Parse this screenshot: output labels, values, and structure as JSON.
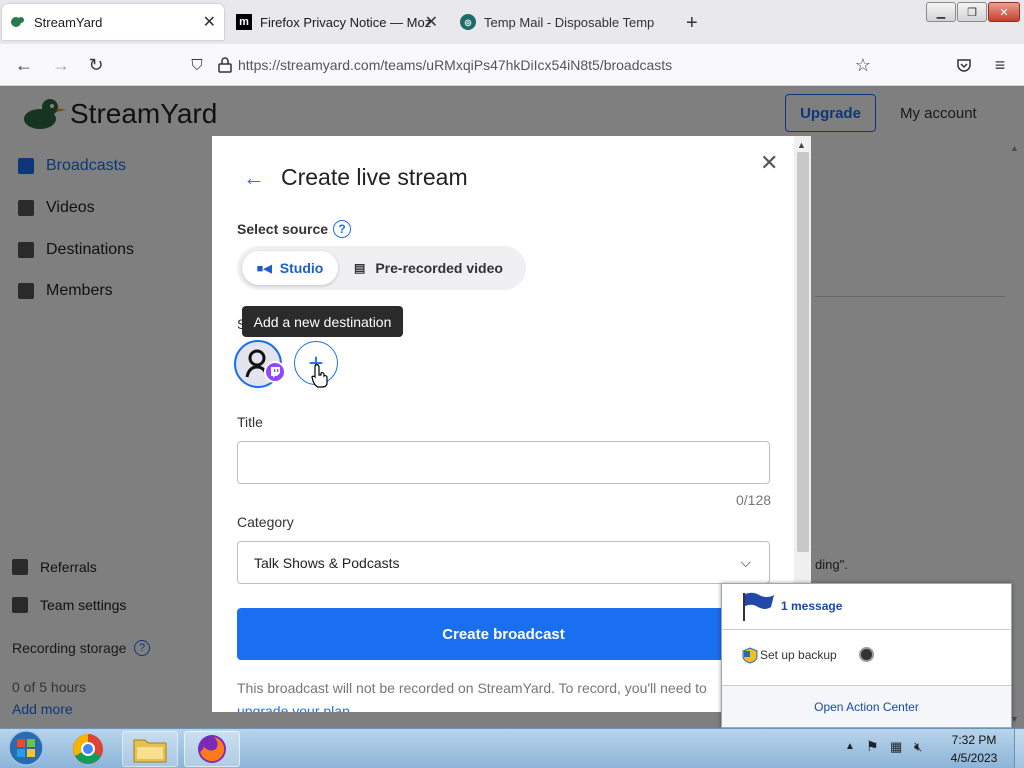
{
  "browser": {
    "tabs": [
      {
        "label": "StreamYard",
        "active": true
      },
      {
        "label": "Firefox Privacy Notice — Mozilla",
        "active": false
      },
      {
        "label": "Temp Mail - Disposable Tempor",
        "active": false
      }
    ],
    "url": "https://streamyard.com/teams/uRMxqiPs47hkDiIcx54iN8t5/broadcasts"
  },
  "app": {
    "logo_text": "StreamYard",
    "upgrade_label": "Upgrade",
    "my_account_label": "My account",
    "sidebar": [
      {
        "label": "Broadcasts",
        "active": true,
        "icon": "broadcast-icon"
      },
      {
        "label": "Videos",
        "icon": "video-icon"
      },
      {
        "label": "Destinations",
        "icon": "share-icon"
      },
      {
        "label": "Members",
        "icon": "members-icon"
      }
    ],
    "sidebar_bottom": {
      "referrals": "Referrals",
      "team_settings": "Team settings",
      "recording_storage": "Recording storage",
      "storage_value": "0 of 5 hours",
      "add_more": "Add more"
    },
    "background_fragment": "ding\"."
  },
  "modal": {
    "title": "Create live stream",
    "select_source_label": "Select source",
    "sources": {
      "studio": "Studio",
      "prerecorded": "Pre-recorded video",
      "selected": "Studio"
    },
    "destinations_label_fragment": "S",
    "tooltip": "Add a new destination",
    "title_label": "Title",
    "title_value": "",
    "title_counter": "0/128",
    "category_label": "Category",
    "category_value": "Talk Shows & Podcasts",
    "create_button": "Create broadcast",
    "footer_text": "This broadcast will not be recorded on StreamYard. To record, you'll need to",
    "footer_link": "upgrade your plan"
  },
  "action_center": {
    "message": "1 message",
    "backup": "Set up backup",
    "open": "Open Action Center"
  },
  "taskbar": {
    "time": "7:32 PM",
    "date": "4/5/2023"
  },
  "colors": {
    "accent": "#1a6ff0",
    "twitch": "#9146ff"
  }
}
